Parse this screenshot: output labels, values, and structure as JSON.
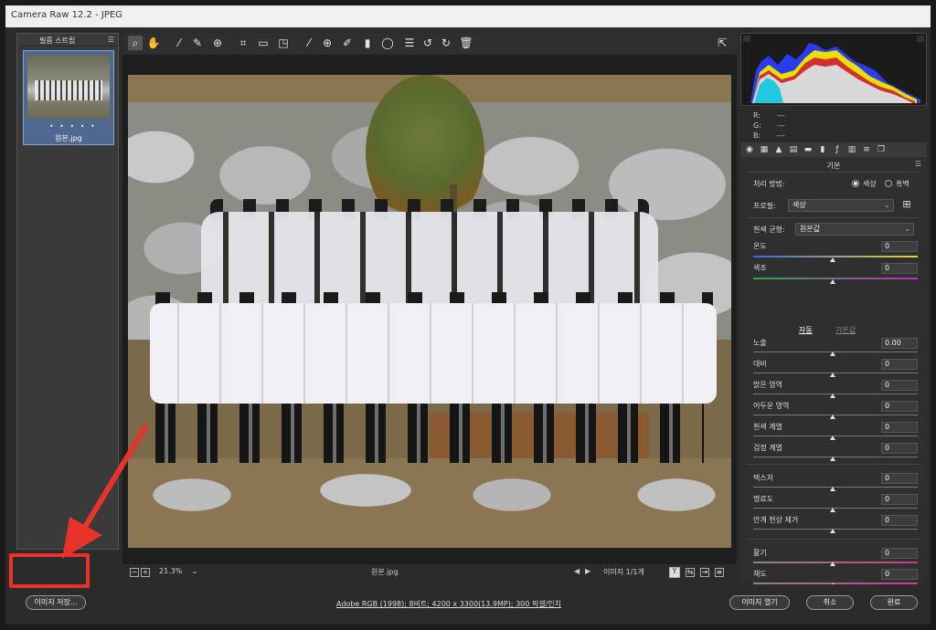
{
  "titlebar": {
    "title": "Camera Raw 12.2  -  JPEG"
  },
  "filmstrip": {
    "title": "필름 스트립",
    "thumbnail_dots": "• • • • •",
    "thumbnail_name": "원본.jpg"
  },
  "toolbar": {
    "tools": [
      "zoom-icon",
      "hand-icon",
      "white-balance-icon",
      "color-sampler-icon",
      "targeted-adjust-icon",
      "crop-icon",
      "straighten-icon",
      "transform-icon",
      "spot-removal-icon",
      "red-eye-icon",
      "adjustment-brush-icon",
      "graduated-filter-icon",
      "radial-filter-icon",
      "preferences-icon",
      "rotate-left-icon",
      "rotate-right-icon",
      "trash-icon"
    ]
  },
  "preview_footer": {
    "zoom": "21.3%",
    "filename": "원본.jpg",
    "image_count": "이미지 1/1개",
    "y_label": "Y"
  },
  "readout": {
    "r": "R:",
    "g": "G:",
    "b": "B:",
    "dash": "---"
  },
  "panel": {
    "title": "기본",
    "treatment_label": "처리 방법:",
    "color_option": "색상",
    "bw_option": "흑백",
    "profile_label": "프로필:",
    "profile_value": "색상",
    "wb_label": "흰색 균형:",
    "wb_value": "원본값",
    "temp_label": "온도",
    "temp_value": "0",
    "tint_label": "색조",
    "tint_value": "0",
    "auto_label": "자동",
    "default_label": "기본값",
    "sliders": [
      {
        "label": "노출",
        "value": "0.00"
      },
      {
        "label": "대비",
        "value": "0"
      },
      {
        "label": "밝은 영역",
        "value": "0"
      },
      {
        "label": "어두운 영역",
        "value": "0"
      },
      {
        "label": "흰색 계열",
        "value": "0"
      },
      {
        "label": "검정 계열",
        "value": "0"
      }
    ],
    "presence": [
      {
        "label": "텍스처",
        "value": "0"
      },
      {
        "label": "명료도",
        "value": "0"
      },
      {
        "label": "안개 현상 제거",
        "value": "0"
      }
    ],
    "color_sliders": [
      {
        "label": "활기",
        "value": "0"
      },
      {
        "label": "채도",
        "value": "0"
      }
    ]
  },
  "bottom": {
    "save_label": "이미지 저장...",
    "workflow_text": "Adobe RGB (1998); 8비트; 4200 x 3300(13.9MP); 300 픽셀/인치",
    "open_label": "이미지 열기",
    "cancel_label": "취소",
    "done_label": "완료"
  },
  "colors": {
    "highlight": "#e8332a",
    "background": "#2b2b2b"
  }
}
